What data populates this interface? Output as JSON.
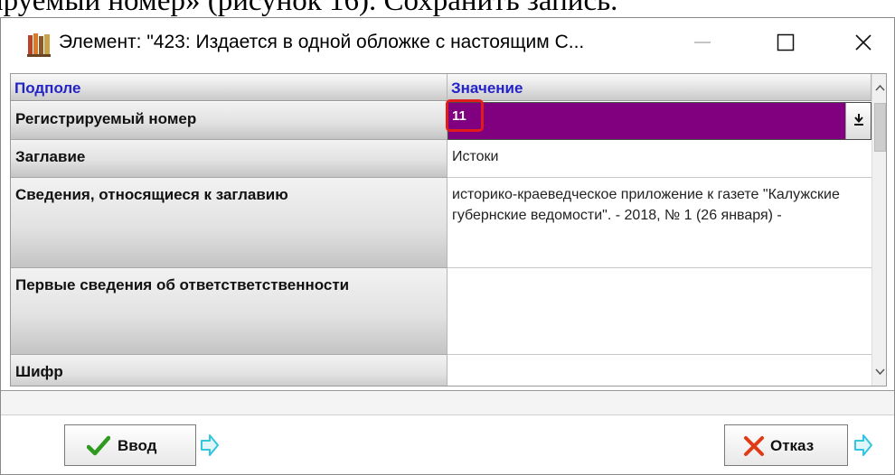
{
  "document": {
    "visible_text": "ируемый номер» (рисунок 16). Сохранить запись."
  },
  "window": {
    "title": "Элемент: \"423: Издается в одной обложке с настоящим С..."
  },
  "grid": {
    "columns": {
      "subfield": "Подполе",
      "value": "Значение"
    },
    "rows": [
      {
        "subfield": "Регистрируемый номер",
        "value": "11",
        "state": "editing"
      },
      {
        "subfield": "Заглавие",
        "value": "Истоки"
      },
      {
        "subfield": "Сведения, относящиеся к заглавию",
        "value": "историко-краеведческое приложение к газете \"Калужские губернские ведомости\". - 2018, № 1 (26 января) -"
      },
      {
        "subfield": "Первые сведения об ответстветственности",
        "value": ""
      },
      {
        "subfield": "Шифр",
        "value": ""
      }
    ]
  },
  "buttons": {
    "ok_label": "Ввод",
    "cancel_label": "Отказ"
  },
  "colors": {
    "editing_cell": "#800080",
    "highlight_box": "#e21b1b",
    "header_text": "#2323c8",
    "ok_check": "#2e9a1e",
    "cancel_cross": "#e03a16",
    "next_arrow": "#34c5e0"
  },
  "icons": {
    "app": "books-icon",
    "dropdown": "down-arrow-icon",
    "ok": "checkmark-icon",
    "cancel": "x-icon",
    "next": "right-arrow-icon"
  }
}
